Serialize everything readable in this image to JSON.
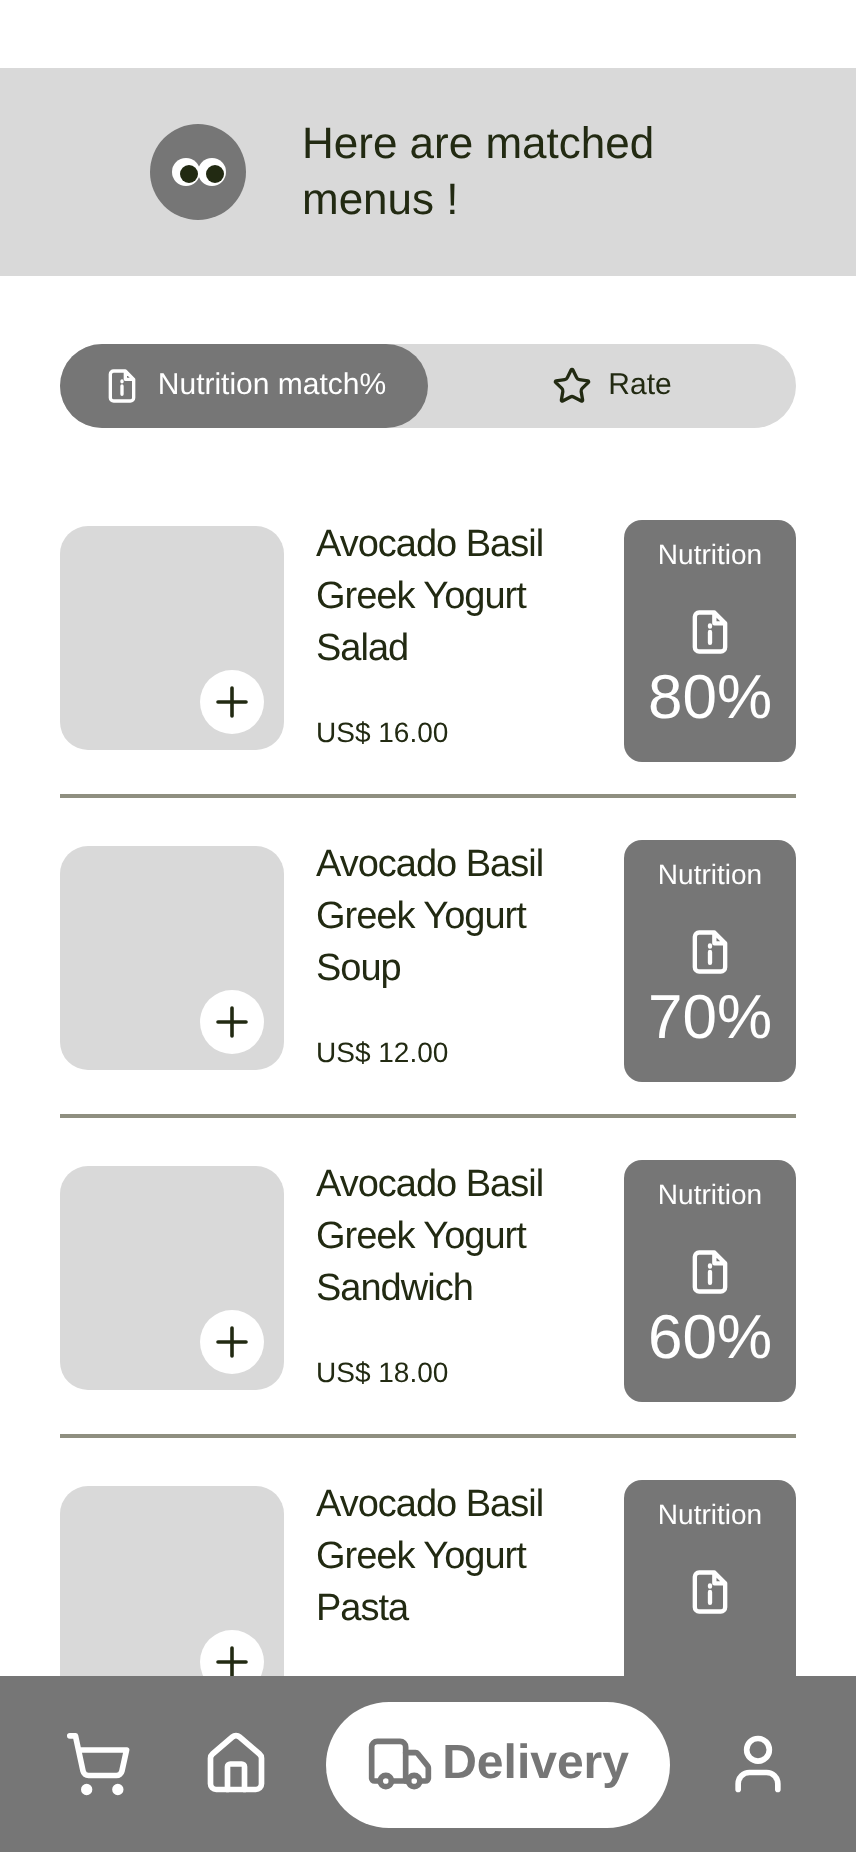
{
  "banner": {
    "message": "Here are matched menus !"
  },
  "sort_tabs": [
    {
      "label": "Nutrition match%",
      "kind": "nutrition",
      "selected": true
    },
    {
      "label": "Rate",
      "kind": "rate",
      "selected": false
    }
  ],
  "menus": [
    {
      "name": "Avocado Basil Greek Yogurt Salad",
      "price": "US$ 16.00",
      "badge_label": "Nutrition",
      "match": "80%"
    },
    {
      "name": "Avocado Basil Greek Yogurt Soup",
      "price": "US$ 12.00",
      "badge_label": "Nutrition",
      "match": "70%"
    },
    {
      "name": "Avocado Basil Greek Yogurt Sandwich",
      "price": "US$ 18.00",
      "badge_label": "Nutrition",
      "match": "60%"
    },
    {
      "name": "Avocado Basil Greek Yogurt Pasta",
      "badge_label": "Nutrition"
    }
  ],
  "bottom_nav": [
    {
      "kind": "cart",
      "selected": false
    },
    {
      "kind": "home",
      "selected": false
    },
    {
      "kind": "delivery",
      "label": "Delivery",
      "selected": true
    },
    {
      "kind": "profile",
      "selected": false
    }
  ]
}
